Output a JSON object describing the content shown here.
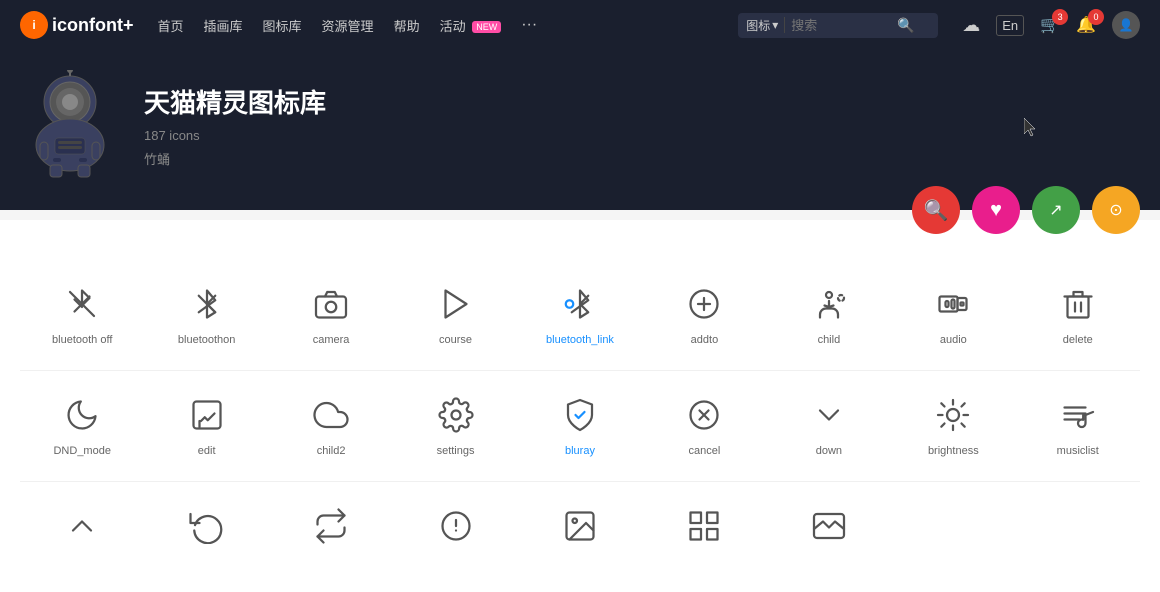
{
  "site": {
    "logo": "iconfont+",
    "logo_icon": "i"
  },
  "nav": {
    "links": [
      "首页",
      "插画库",
      "图标库",
      "资源管理",
      "帮助",
      "活动"
    ],
    "activity_badge": "NEW",
    "search_placeholder": "搜索",
    "search_type": "图标",
    "cart_count": "3",
    "notif_count": "0",
    "upload_label": "上传"
  },
  "banner": {
    "title": "天猫精灵图标库",
    "count": "187 icons",
    "author": "竹蛹",
    "actions": [
      {
        "id": "search",
        "symbol": "🔍",
        "color": "btn-red"
      },
      {
        "id": "like",
        "symbol": "♥",
        "color": "btn-pink"
      },
      {
        "id": "share",
        "symbol": "↗",
        "color": "btn-green"
      },
      {
        "id": "download",
        "symbol": "⊙",
        "color": "btn-orange"
      }
    ]
  },
  "icons_row1": [
    {
      "id": "bluetooth-off",
      "label": "bluetooth off",
      "label_class": "",
      "type": "bluetooth-off"
    },
    {
      "id": "bluetoothon",
      "label": "bluetoothon",
      "label_class": "",
      "type": "bluetooth"
    },
    {
      "id": "camera",
      "label": "camera",
      "label_class": "",
      "type": "camera"
    },
    {
      "id": "course",
      "label": "course",
      "label_class": "",
      "type": "course"
    },
    {
      "id": "bluetooth-link",
      "label": "bluetooth_link",
      "label_class": "blue",
      "type": "bluetooth-link"
    },
    {
      "id": "addto",
      "label": "addto",
      "label_class": "",
      "type": "addto"
    },
    {
      "id": "child",
      "label": "child",
      "label_class": "",
      "type": "child"
    },
    {
      "id": "audio",
      "label": "audio",
      "label_class": "",
      "type": "audio"
    },
    {
      "id": "delete",
      "label": "delete",
      "label_class": "",
      "type": "delete"
    }
  ],
  "icons_row2": [
    {
      "id": "dnd-mode",
      "label": "DND_mode",
      "label_class": "",
      "type": "moon"
    },
    {
      "id": "edit",
      "label": "edit",
      "label_class": "",
      "type": "edit"
    },
    {
      "id": "child2",
      "label": "child2",
      "label_class": "",
      "type": "cloud"
    },
    {
      "id": "settings",
      "label": "settings",
      "label_class": "",
      "type": "settings"
    },
    {
      "id": "bluray",
      "label": "bluray",
      "label_class": "blue",
      "type": "bluray"
    },
    {
      "id": "cancel",
      "label": "cancel",
      "label_class": "",
      "type": "cancel"
    },
    {
      "id": "down",
      "label": "down",
      "label_class": "",
      "type": "down"
    },
    {
      "id": "brightness",
      "label": "brightness",
      "label_class": "",
      "type": "brightness"
    },
    {
      "id": "musiclist",
      "label": "musiclist",
      "label_class": "",
      "type": "musiclist"
    }
  ]
}
